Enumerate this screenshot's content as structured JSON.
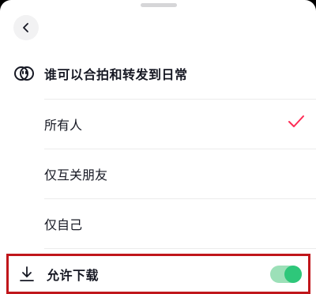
{
  "header": {
    "back_icon": "chevron-left-icon"
  },
  "section": {
    "icon": "duet-icon",
    "title": "谁可以合拍和转发到日常"
  },
  "options": [
    {
      "label": "所有人",
      "selected": true
    },
    {
      "label": "仅互关朋友",
      "selected": false
    },
    {
      "label": "仅自己",
      "selected": false
    }
  ],
  "download": {
    "icon": "download-icon",
    "label": "允许下载",
    "enabled": true
  },
  "colors": {
    "check": "#fe2c55",
    "highlight_border": "#c0161b",
    "toggle_on": "#2ec77a"
  }
}
